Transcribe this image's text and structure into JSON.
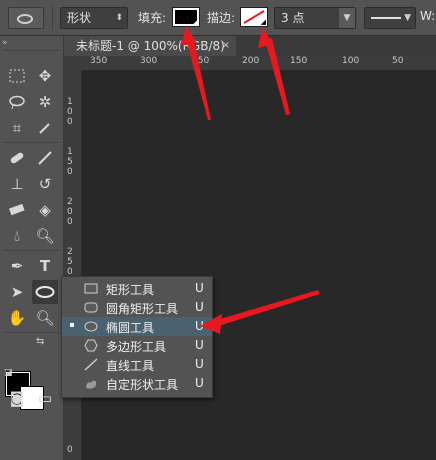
{
  "options_bar": {
    "mode_select": "形状",
    "fill_label": "填充:",
    "stroke_label": "描边:",
    "stroke_size": "3 点",
    "w_label": "W:"
  },
  "document_tab": {
    "title": "未标题-1 @ 100%(RGB/8)",
    "close": "×"
  },
  "ruler": {
    "h_labels": [
      "350",
      "300",
      "250",
      "200",
      "150",
      "100",
      "50"
    ],
    "v_labels": [
      "1",
      "0",
      "0",
      "1",
      "5",
      "0",
      "2",
      "0",
      "0",
      "2",
      "5",
      "0",
      "0"
    ]
  },
  "shape_menu": {
    "items": [
      {
        "label": "矩形工具",
        "key": "U",
        "icon": "rectangle-icon",
        "selected": false
      },
      {
        "label": "圆角矩形工具",
        "key": "U",
        "icon": "rounded-rectangle-icon",
        "selected": false
      },
      {
        "label": "椭圆工具",
        "key": "U",
        "icon": "ellipse-icon",
        "selected": true
      },
      {
        "label": "多边形工具",
        "key": "U",
        "icon": "polygon-icon",
        "selected": false
      },
      {
        "label": "直线工具",
        "key": "U",
        "icon": "line-icon",
        "selected": false
      },
      {
        "label": "自定形状工具",
        "key": "U",
        "icon": "custom-shape-icon",
        "selected": false
      }
    ]
  },
  "colors": {
    "annotation_arrow": "#e8191e",
    "menu_selection": "#4a6170",
    "foreground": "#000000",
    "background": "#ffffff"
  }
}
